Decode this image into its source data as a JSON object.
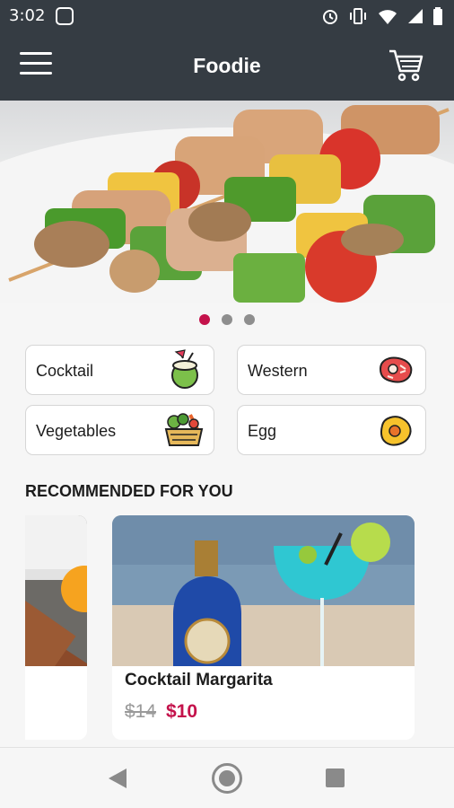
{
  "status": {
    "time": "3:02"
  },
  "app": {
    "title": "Foodie"
  },
  "categories": [
    {
      "label": "Cocktail",
      "icon": "coconut-drink-icon"
    },
    {
      "label": "Western",
      "icon": "steak-icon"
    },
    {
      "label": "Vegetables",
      "icon": "vegetable-basket-icon"
    },
    {
      "label": "Egg",
      "icon": "fried-egg-icon"
    }
  ],
  "carousel": {
    "pages": 3,
    "active": 0
  },
  "recommended": {
    "title": "RECOMMENDED FOR YOU",
    "items": [
      {
        "name": "Cocktail Margarita",
        "old_price": "$14",
        "price": "$10"
      }
    ]
  },
  "colors": {
    "accent": "#c4124b",
    "header": "#353c43"
  }
}
